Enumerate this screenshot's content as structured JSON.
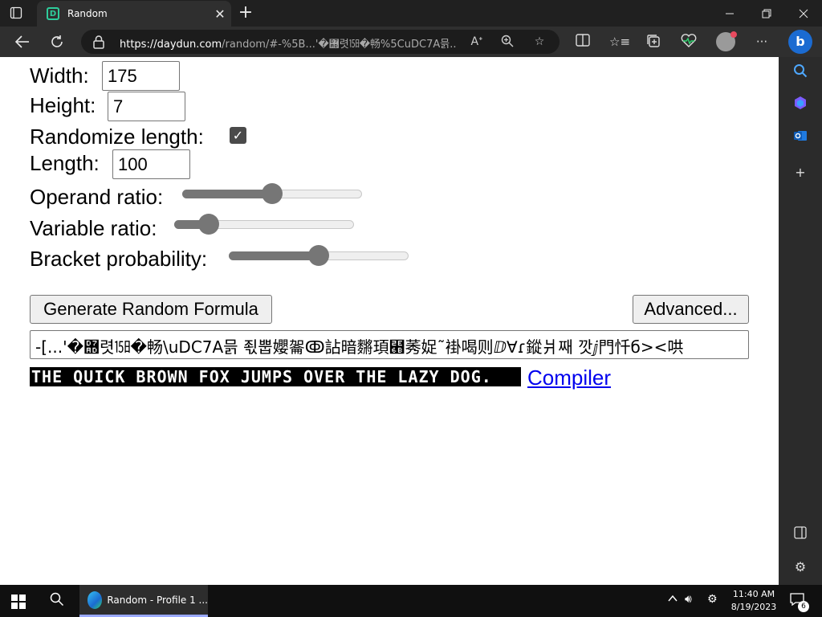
{
  "browser": {
    "tab_title": "Random",
    "url_host": "https://daydun.com",
    "url_path": "/random/#-%5B...'�힭렷㏮�畅%5CuDC7A믉...",
    "close_symbol": "✕",
    "new_tab_symbol": "+"
  },
  "form": {
    "width_label": "Width:",
    "width_value": "175",
    "height_label": "Height:",
    "height_value": "7",
    "randomize_label": "Randomize length:",
    "randomize_checked": true,
    "length_label": "Length:",
    "length_value": "100",
    "operand_label": "Operand ratio:",
    "operand_value": 0.5,
    "variable_label": "Variable ratio:",
    "variable_value": 0.15,
    "bracket_label": "Bracket probability:",
    "bracket_value": 0.5
  },
  "buttons": {
    "generate_label": "Generate Random Formula",
    "advanced_label": "Advanced..."
  },
  "formula_text": "-[...'�힭렷㏮�畅\\uDC7A믉 죇뿝孆嗧ↂ詀暗䵁頊⹫莠娖˜褂喝则ⅅ∀ɾ鏦爿째 깟ⅉ門忏б><哄",
  "banner_text": "THE QUICK BROWN FOX JUMPS OVER THE LAZY DOG.",
  "compiler_link": "Compiler",
  "taskbar": {
    "app_label": "Random - Profile 1 ...",
    "time": "11:40 AM",
    "date": "8/19/2023",
    "notification_count": "6"
  },
  "colors": {
    "accent_edge": "#1b6bd1",
    "slider_gray": "#767676",
    "link_blue": "#0000ee"
  },
  "icons": [
    "tab-actions-icon",
    "favicon-icon",
    "close-icon",
    "new-tab-icon",
    "minimize-icon",
    "restore-icon",
    "window-close-icon",
    "back-icon",
    "refresh-icon",
    "lock-icon",
    "read-aloud-icon",
    "zoom-icon",
    "favorite-icon",
    "split-screen-icon",
    "favorites-icon",
    "collections-icon",
    "performance-icon",
    "profile-icon",
    "more-icon",
    "bing-icon",
    "search-icon",
    "copilot-icon",
    "outlook-icon",
    "add-icon",
    "sidebar-toggle-icon",
    "settings-icon",
    "windows-start-icon",
    "taskbar-search-icon",
    "edge-icon",
    "chevron-up-icon",
    "volume-icon",
    "gear-icon",
    "notification-icon"
  ]
}
